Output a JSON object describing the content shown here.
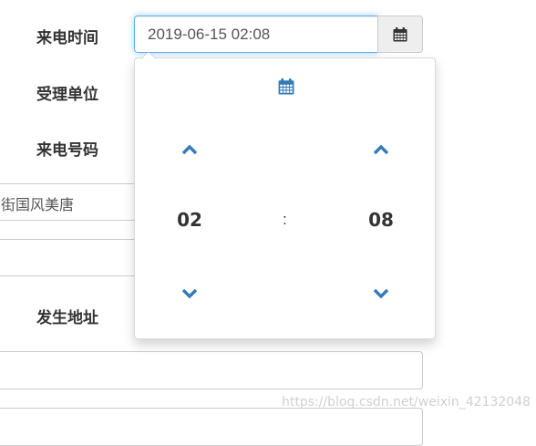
{
  "form": {
    "call_time_label": "来电时间",
    "unit_label": "受理单位",
    "phone_label": "来电号码",
    "address_label": "发生地址",
    "address_partial_value": "街国风美唐",
    "datetime_value": "2019-06-15 02:08"
  },
  "picker": {
    "hour": "02",
    "minute": "08",
    "separator": ":"
  },
  "colors": {
    "accent": "#337ab7",
    "focus_border": "#66afe9"
  },
  "watermark": "https://blog.csdn.net/weixin_42132048"
}
